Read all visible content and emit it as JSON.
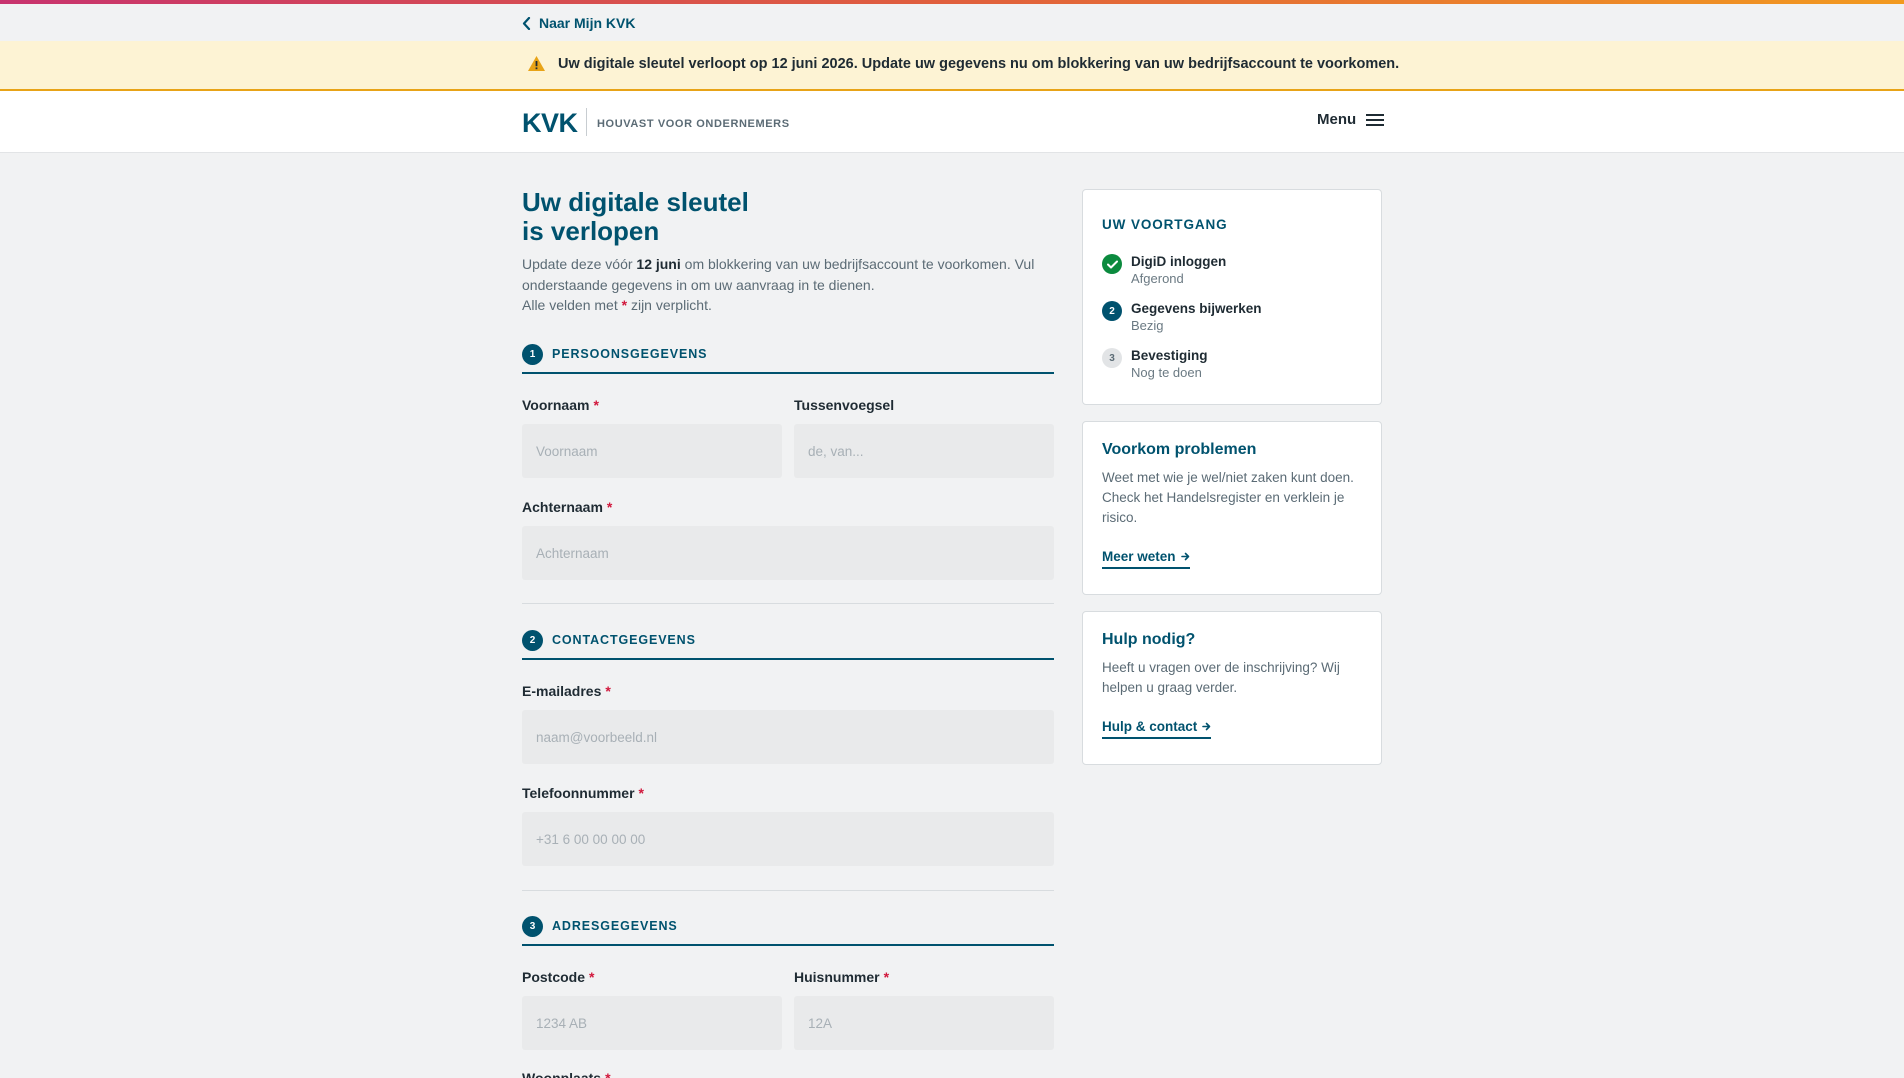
{
  "nav": {
    "back_label": "Naar Mijn KVK"
  },
  "alert": {
    "text_before": "Uw digitale sleutel verloopt op ",
    "date": "12 juni 2026",
    "text_after": ". Update uw gegevens nu om blokkering van uw bedrijfsaccount te voorkomen."
  },
  "header": {
    "logo": "KVK",
    "tagline": "HOUVAST VOOR ONDERNEMERS",
    "menu_label": "Menu"
  },
  "page": {
    "title_line1": "Uw digitale sleutel",
    "title_line2": "is verlopen",
    "intro_1": "Update deze vóór ",
    "intro_date": "12 juni",
    "intro_2": " om blokkering van uw bedrijfsaccount te voorkomen. Vul onderstaande gegevens in om uw aanvraag in te dienen.",
    "intro_3": "Alle velden met ",
    "intro_star": "*",
    "intro_4": " zijn verplicht."
  },
  "sections": [
    {
      "number": "1",
      "title": "PERSOONSGEGEVENS"
    },
    {
      "number": "2",
      "title": "CONTACTGEGEVENS"
    },
    {
      "number": "3",
      "title": "ADRESGEGEVENS"
    }
  ],
  "fields": {
    "voornaam": {
      "label": "Voornaam",
      "placeholder": "Voornaam",
      "value": ""
    },
    "tussenvoegsel": {
      "label": "Tussenvoegsel",
      "placeholder": "de, van...",
      "value": ""
    },
    "achternaam": {
      "label": "Achternaam",
      "placeholder": "Achternaam",
      "value": ""
    },
    "email": {
      "label": "E-mailadres",
      "placeholder": "naam@voorbeeld.nl",
      "value": ""
    },
    "telefoon": {
      "label": "Telefoonnummer",
      "placeholder": "+31 6 00 00 00 00",
      "value": ""
    },
    "postcode": {
      "label": "Postcode",
      "placeholder": "1234 AB",
      "value": ""
    },
    "huisnummer": {
      "label": "Huisnummer",
      "placeholder": "12A",
      "value": ""
    },
    "woonplaats": {
      "label": "Woonplaats"
    }
  },
  "required_marker": "*",
  "progress": {
    "title": "UW VOORTGANG",
    "steps": [
      {
        "number": "1",
        "name": "DigiD inloggen",
        "status": "Afgerond",
        "state": "done"
      },
      {
        "number": "2",
        "name": "Gegevens bijwerken",
        "status": "Bezig",
        "state": "active"
      },
      {
        "number": "3",
        "name": "Bevestiging",
        "status": "Nog te doen",
        "state": "todo"
      }
    ]
  },
  "cards": {
    "prevent": {
      "title": "Voorkom problemen",
      "text": "Weet met wie je wel/niet zaken kunt doen. Check het Handelsregister en verklein je risico.",
      "link": "Meer weten"
    },
    "help": {
      "title": "Hulp nodig?",
      "text": "Heeft u vragen over de inschrijving? Wij helpen u graag verder.",
      "link": "Hulp & contact"
    }
  },
  "colors": {
    "brand": "#00526e",
    "alert_bg": "#fdf3d4",
    "alert_border": "#e8a317",
    "required": "#d1183c",
    "done": "#0b8a3e"
  },
  "icons": {
    "back": "chevron-left-icon",
    "alert": "warning-icon",
    "menu": "hamburger-icon",
    "done": "check-icon",
    "link": "arrow-right-icon"
  }
}
